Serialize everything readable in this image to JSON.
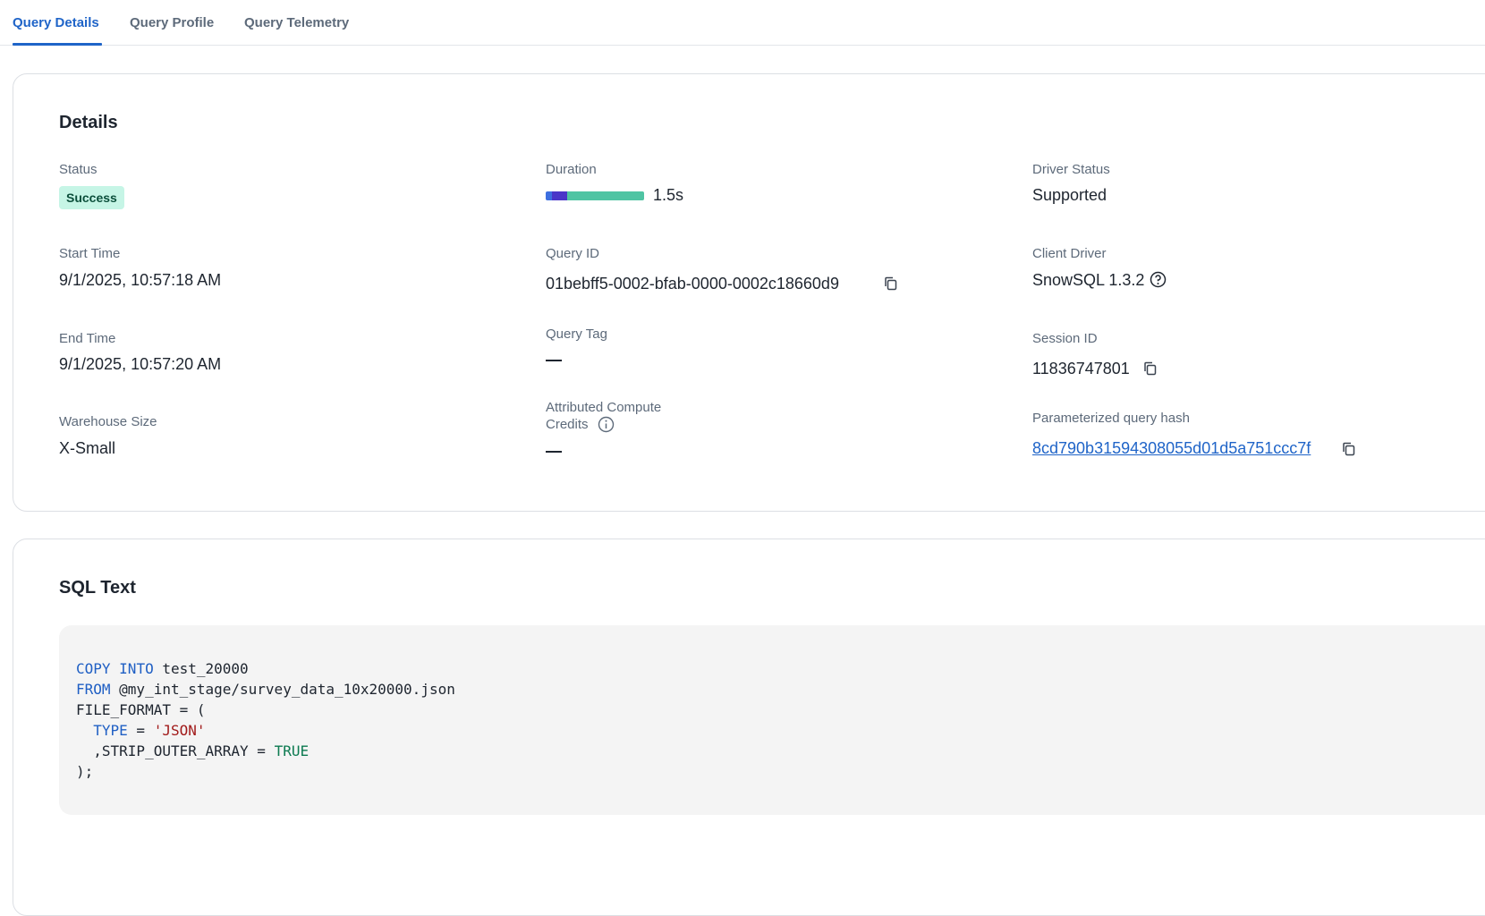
{
  "tabs": [
    {
      "label": "Query Details",
      "active": true
    },
    {
      "label": "Query Profile",
      "active": false
    },
    {
      "label": "Query Telemetry",
      "active": false
    }
  ],
  "details": {
    "title": "Details",
    "status": {
      "label": "Status",
      "value": "Success"
    },
    "duration": {
      "label": "Duration",
      "value": "1.5s",
      "segments": [
        {
          "fraction": 0.06,
          "color": "#3d6fe0"
        },
        {
          "fraction": 0.16,
          "color": "#4a36c8"
        },
        {
          "fraction": 0.78,
          "color": "#4fc4a3"
        }
      ]
    },
    "driver_status": {
      "label": "Driver Status",
      "value": "Supported"
    },
    "start_time": {
      "label": "Start Time",
      "value": "9/1/2025, 10:57:18 AM"
    },
    "query_id": {
      "label": "Query ID",
      "value": "01bebff5-0002-bfab-0000-0002c18660d9"
    },
    "client_driver": {
      "label": "Client Driver",
      "value": "SnowSQL 1.3.2"
    },
    "end_time": {
      "label": "End Time",
      "value": "9/1/2025, 10:57:20 AM"
    },
    "query_tag": {
      "label": "Query Tag",
      "value": "—"
    },
    "session_id": {
      "label": "Session ID",
      "value": "11836747801"
    },
    "warehouse_size": {
      "label": "Warehouse Size",
      "value": "X-Small"
    },
    "attributed_credits": {
      "label_line1": "Attributed Compute",
      "label_line2": "Credits",
      "value": "—"
    },
    "param_hash": {
      "label": "Parameterized query hash",
      "value": "8cd790b31594308055d01d5a751ccc7f"
    }
  },
  "sql": {
    "title": "SQL Text",
    "l1_kw1": "COPY",
    "l1_kw2": "INTO",
    "l1_rest": " test_20000",
    "l2_kw": "FROM",
    "l2_rest": " @my_int_stage/survey_data_10x20000.json",
    "l3": "FILE_FORMAT = (",
    "l4_indent": "  ",
    "l4_kw": "TYPE",
    "l4_eq": " = ",
    "l4_str": "'JSON'",
    "l5_text": "  ,STRIP_OUTER_ARRAY = ",
    "l5_bool": "TRUE",
    "l6": ");"
  },
  "colors": {
    "accent": "#1f64c8",
    "success_bg": "#c6f5e6"
  }
}
